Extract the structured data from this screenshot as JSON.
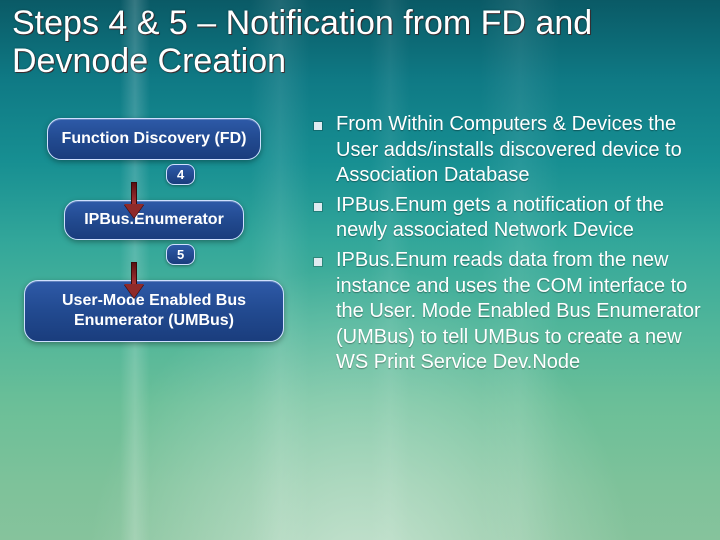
{
  "title": "Steps 4 & 5 – Notification from FD and Devnode Creation",
  "diagram": {
    "node1": "Function Discovery (FD)",
    "step1": "4",
    "node2": "IPBus.Enumerator",
    "step2": "5",
    "node3": "User-Mode Enabled Bus Enumerator (UMBus)"
  },
  "bullets": [
    "From Within Computers & Devices the User adds/installs discovered device to Association Database",
    "IPBus.Enum gets a  notification of the newly associated Network Device",
    "IPBus.Enum reads data from the new instance and uses the COM interface to the User. Mode Enabled Bus Enumerator (UMBus) to tell UMBus to create a new WS Print Service Dev.Node"
  ]
}
